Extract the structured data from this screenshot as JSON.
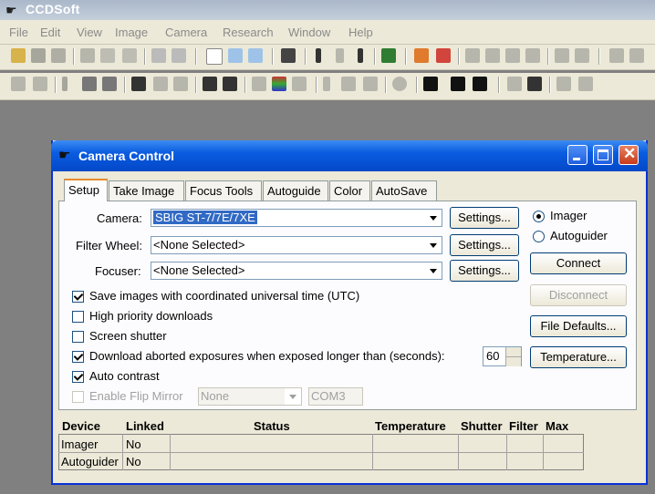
{
  "app": {
    "title": "CCDSoft"
  },
  "menu": [
    "File",
    "Edit",
    "View",
    "Image",
    "Camera",
    "Research",
    "Window",
    "Help"
  ],
  "dialog": {
    "title": "Camera Control",
    "tabs": [
      "Setup",
      "Take Image",
      "Focus Tools",
      "Autoguide",
      "Color",
      "AutoSave"
    ],
    "camera": {
      "label": "Camera:",
      "value": "SBIG ST-7/7E/7XE",
      "settings": "Settings..."
    },
    "filter_wheel": {
      "label": "Filter Wheel:",
      "value": "<None Selected>",
      "settings": "Settings..."
    },
    "focuser": {
      "label": "Focuser:",
      "value": "<None Selected>",
      "settings": "Settings..."
    },
    "options": [
      {
        "label": "Save images with coordinated universal time (UTC)",
        "checked": true
      },
      {
        "label": "High priority downloads",
        "checked": false
      },
      {
        "label": "Screen shutter",
        "checked": false
      },
      {
        "label": "Download aborted exposures when exposed longer than (seconds):",
        "checked": true
      },
      {
        "label": "Auto contrast",
        "checked": true
      },
      {
        "label": "Enable Flip Mirror",
        "checked": false,
        "disabled": true
      }
    ],
    "download_seconds": "60",
    "flip_mirror_mode": "None",
    "flip_mirror_port": "COM3",
    "radios": {
      "imager": "Imager",
      "autoguider": "Autoguider"
    },
    "buttons": {
      "connect": "Connect",
      "disconnect": "Disconnect",
      "file_defaults": "File Defaults...",
      "temperature": "Temperature..."
    },
    "table": {
      "headers": [
        "Device",
        "Linked",
        "Status",
        "Temperature",
        "Shutter",
        "Filter",
        "Max"
      ],
      "rows": [
        {
          "device": "Imager",
          "linked": "No"
        },
        {
          "device": "Autoguider",
          "linked": "No"
        }
      ]
    }
  },
  "colors": {
    "dialog_title": "#0a5ce0",
    "selection": "#316ac5",
    "face": "#ece9d8"
  }
}
